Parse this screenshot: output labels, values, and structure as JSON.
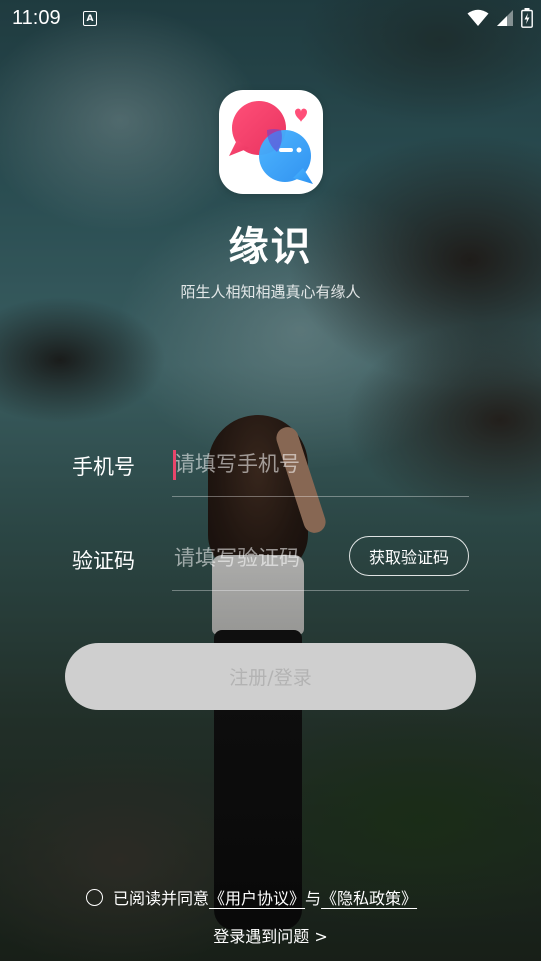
{
  "status": {
    "time": "11:09",
    "notif_letter": "A",
    "icons": [
      "wifi-icon",
      "signal-icon",
      "battery-icon"
    ]
  },
  "app": {
    "name": "缘识",
    "slogan": "陌生人相知相遇真心有缘人",
    "brand_colors": {
      "pink": "#f0437a",
      "blue": "#3aa6f5"
    }
  },
  "form": {
    "phone": {
      "label": "手机号",
      "placeholder": "请填写手机号",
      "value": ""
    },
    "code": {
      "label": "验证码",
      "placeholder": "请填写验证码",
      "value": "",
      "button": "获取验证码"
    },
    "submit": "注册/登录"
  },
  "agreement": {
    "prefix": "已阅读并同意",
    "user_agreement": "《用户协议》",
    "and": "与",
    "privacy_policy": "《隐私政策》"
  },
  "help": "登录遇到问题 >"
}
